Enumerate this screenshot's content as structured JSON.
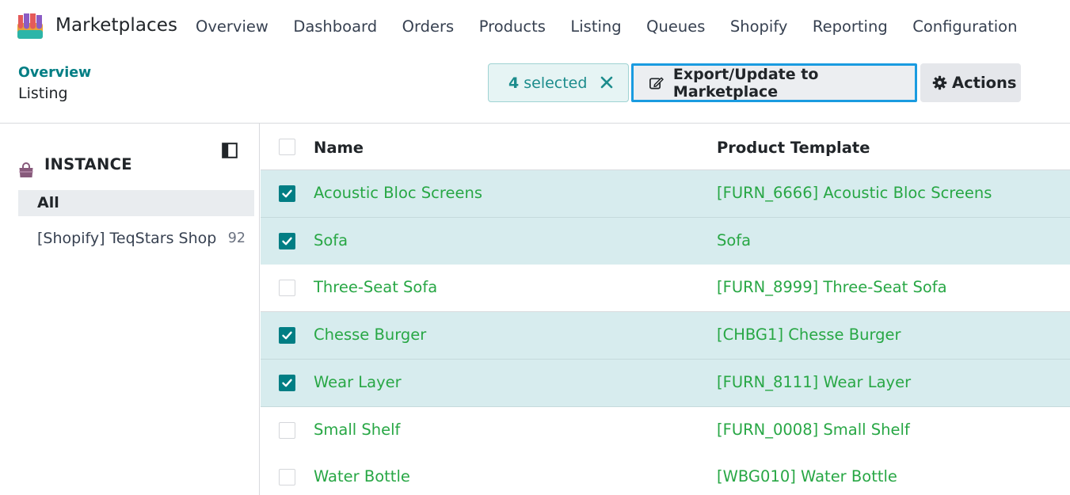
{
  "navbar": {
    "app_name": "Marketplaces",
    "menu": [
      "Overview",
      "Dashboard",
      "Orders",
      "Products",
      "Listing",
      "Queues",
      "Shopify",
      "Reporting",
      "Configuration"
    ]
  },
  "breadcrumb": {
    "parent": "Overview",
    "current": "Listing"
  },
  "selection": {
    "count": "4",
    "label": "selected"
  },
  "toolbar": {
    "export_label": "Export/Update to Marketplace",
    "actions_label": "Actions"
  },
  "sidebar": {
    "section_title": "INSTANCE",
    "items": [
      {
        "label": "All",
        "count": ""
      },
      {
        "label": "[Shopify] TeqStars Shop",
        "count": "92"
      }
    ]
  },
  "table": {
    "columns": [
      "Name",
      "Product Template"
    ],
    "rows": [
      {
        "name": "Acoustic Bloc Screens",
        "template": "[FURN_6666] Acoustic Bloc Screens",
        "checked": true
      },
      {
        "name": "Sofa",
        "template": "Sofa",
        "checked": true
      },
      {
        "name": "Three-Seat Sofa",
        "template": "[FURN_8999] Three-Seat Sofa",
        "checked": false
      },
      {
        "name": "Chesse Burger",
        "template": "[CHBG1] Chesse Burger",
        "checked": true
      },
      {
        "name": "Wear Layer",
        "template": "[FURN_8111] Wear Layer",
        "checked": true
      },
      {
        "name": "Small Shelf",
        "template": "[FURN_0008] Small Shelf",
        "checked": false
      },
      {
        "name": "Water Bottle",
        "template": "[WBG010] Water Bottle",
        "checked": false
      }
    ]
  },
  "icons": {
    "app_logo": "shop-awning-icon",
    "close": "close-icon",
    "edit": "edit-icon",
    "gear": "gear-icon",
    "panel_toggle": "sidebar-toggle-icon",
    "instance": "shopping-bag-icon"
  },
  "colors": {
    "accent": "#017e84",
    "link_green": "#28a745",
    "selected_row": "#d7ecee",
    "focus_border": "#1a9be0"
  }
}
